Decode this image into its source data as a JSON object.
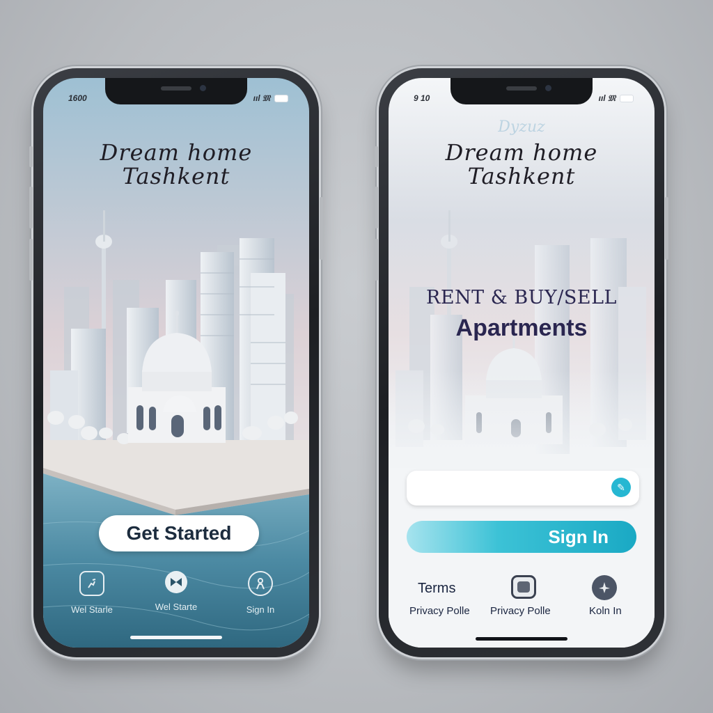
{
  "left_phone": {
    "status_time": "1600",
    "status_signal": "ııl 𝔐",
    "title_line1": "Dream home",
    "title_line2": "Tashkent",
    "cta_label": "Get Started",
    "nav": [
      {
        "label": "Wel Starle",
        "icon": "running-person-icon"
      },
      {
        "label": "Wel Starte",
        "icon": "bowtie-icon"
      },
      {
        "label": "Sign In",
        "icon": "person-icon"
      }
    ]
  },
  "right_phone": {
    "status_time": "9 10",
    "status_signal": "ııl 𝔐",
    "ghost_text": "Dyzuz",
    "title_line1": "Dream home",
    "title_line2": "Tashkent",
    "headline_line1": "RENT & BUY/SELL",
    "headline_line2": "Apartments",
    "input_value": "",
    "signin_label": "Sign In",
    "footer": [
      {
        "top": "Terms",
        "bottom": "Privacy Polle"
      },
      {
        "bottom": "Privacy Polle",
        "icon": "rounded-square-icon"
      },
      {
        "bottom": "Koln In",
        "icon": "airplane-icon"
      }
    ]
  },
  "colors": {
    "accent": "#26b7d2",
    "headline": "#2a2650",
    "sky_top": "#a6c3d6",
    "sky_bottom": "#e4d5d8",
    "water": "#4a8aa3"
  }
}
